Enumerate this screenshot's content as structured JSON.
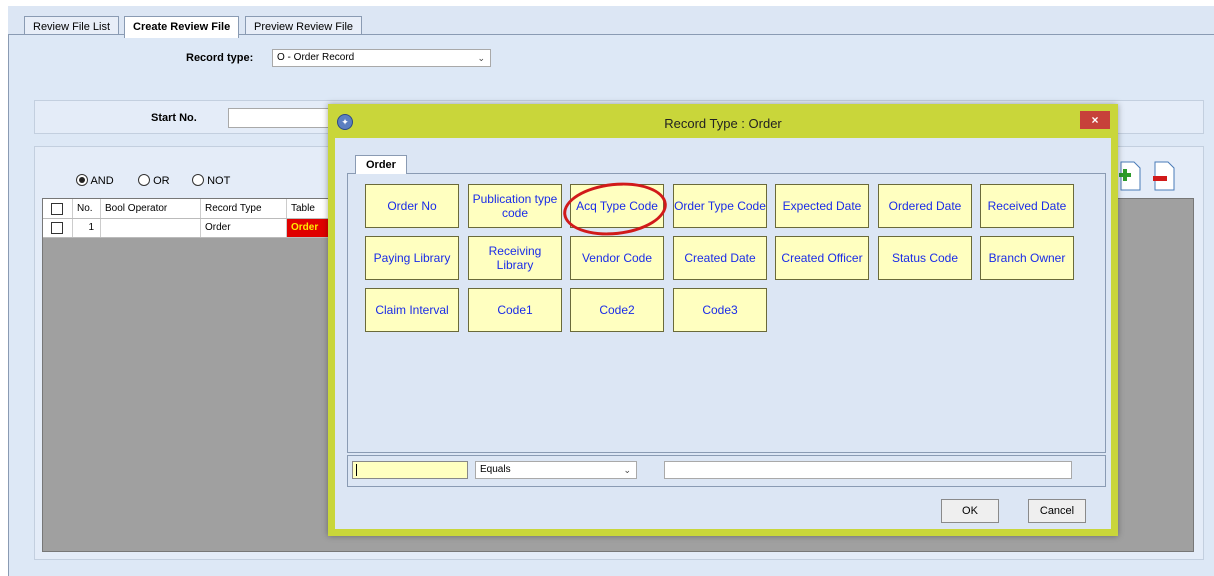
{
  "tabs": [
    "Review File List",
    "Create Review File",
    "Preview Review File"
  ],
  "record_type": {
    "label": "Record type:",
    "value": "O - Order Record"
  },
  "start_no_label": "Start No.",
  "bool_options": [
    "AND",
    "OR",
    "NOT"
  ],
  "grid": {
    "headers": [
      "No.",
      "Bool Operator",
      "Record Type",
      "Table"
    ],
    "row": {
      "no": "1",
      "bool_operator": "",
      "record_type": "Order",
      "table": "Order"
    }
  },
  "dialog": {
    "title": "Record Type : Order",
    "close": "×",
    "tab": "Order",
    "fields": [
      [
        "Order No",
        "Publication type code",
        "Acq Type Code",
        "Order Type Code",
        "Expected Date",
        "Ordered Date",
        "Received Date"
      ],
      [
        "Paying Library",
        "Receiving Library",
        "Vendor Code",
        "Created Date",
        "Created Officer",
        "Status Code",
        "Branch Owner"
      ],
      [
        "Claim Interval",
        "Code1",
        "Code2",
        "Code3"
      ]
    ],
    "condition": {
      "field_value": "",
      "operator": "Equals",
      "value": ""
    },
    "ok": "OK",
    "cancel": "Cancel"
  },
  "icons": [
    "add-document-icon",
    "remove-document-icon"
  ],
  "colors": {
    "field_button_bg": "#ffffc0",
    "field_text": "#1a2ce8",
    "dialog_frame": "#c9d63a",
    "highlight_circle": "#d11a1a",
    "table_cell_red": "#e00000"
  }
}
